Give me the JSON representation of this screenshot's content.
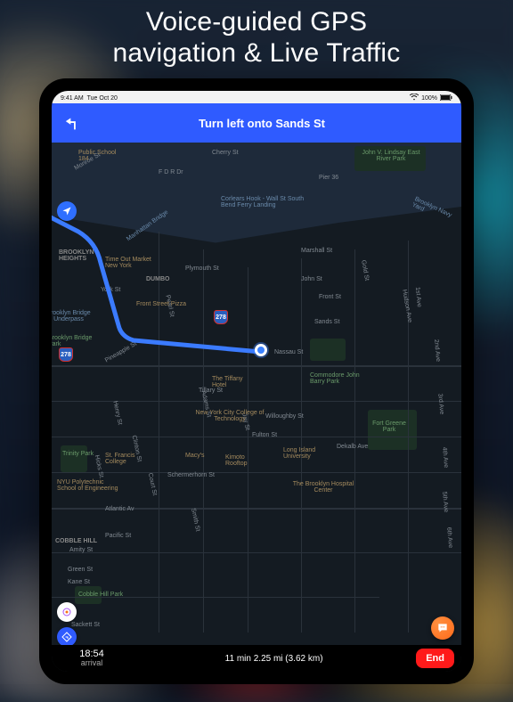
{
  "headline_line1": "Voice-guided GPS",
  "headline_line2": "navigation & Live Traffic",
  "status": {
    "time": "9:41 AM",
    "date": "Tue Oct 20",
    "battery": "100%"
  },
  "nav": {
    "instruction": "Turn left onto Sands St"
  },
  "bottom": {
    "eta_time": "18:54",
    "eta_label": "arrival",
    "summary": "11 min 2.25 mi (3.62 km)",
    "end_label": "End"
  },
  "highway": "278",
  "streets": {
    "cherry": "Cherry St",
    "fdr": "F D R Dr",
    "monroe": "Monroe St",
    "pier36": "Pier 36",
    "marshall": "Marshall St",
    "plymouth": "Plymouth St",
    "john": "John St",
    "york": "York St",
    "front": "Front St",
    "nassau": "Nassau St",
    "tillary": "Tillary St",
    "fulton": "Fulton St",
    "schermerhorn": "Schermerhorn St",
    "atlantic": "Atlantic Av",
    "dekalb": "Dekalb Ave",
    "willoughby": "Willoughby St",
    "ave1": "1st Ave",
    "ave2": "2nd Ave",
    "ave3": "3rd Ave",
    "ave4": "4th Ave",
    "ave5": "5th Ave",
    "ave6": "6th Ave",
    "pearl": "Pearl St",
    "jay": "Jay St",
    "gold": "Gold St",
    "adams": "Adams St",
    "smith": "Smith St",
    "henry": "Henry St",
    "hicks": "Hicks St",
    "clinton": "Clinton St",
    "court": "Court St",
    "pacific": "Pacific St",
    "amity": "Amity St",
    "green": "Green St",
    "kane": "Kane St",
    "sackett": "Sackett St",
    "pineapple": "Pineapple St",
    "sands": "Sands St",
    "hudson": "Hudson Ave"
  },
  "pois": {
    "lindsay": "John V. Lindsay East River Park",
    "corlears": "Corlears Hook - Wall St South Bend Ferry Landing",
    "ps184": "Public School 184",
    "manhattanbr": "Manhattan Bridge",
    "brooklynbr": "Brooklyn Bridge",
    "underbridge": "Brooklyn Bridge Underpass",
    "dumbo": "DUMBO",
    "timeout": "Time Out Market New York",
    "frontpizza": "Front Street Pizza",
    "brooklynheights": "BROOKLYN HEIGHTS",
    "bridgepark": "Brooklyn Bridge Park",
    "tiffany": "The Tiffany Hotel",
    "nycct": "New York City College of Technology",
    "stfrancis": "St. Francis College",
    "macys": "Macy's",
    "poly": "NYU Polytechnic School of Engineering",
    "kimoto": "Kimoto Rooftop",
    "liu": "Long Island University",
    "commodore": "Commodore John Barry Park",
    "fortgreene": "Fort Greene Park",
    "brooklynhosp": "The Brooklyn Hospital Center",
    "cobble": "COBBLE HILL",
    "cobblepark": "Cobble Hill Park",
    "trinity": "Trinity Park",
    "navyyard": "Brooklyn Navy Yard"
  }
}
